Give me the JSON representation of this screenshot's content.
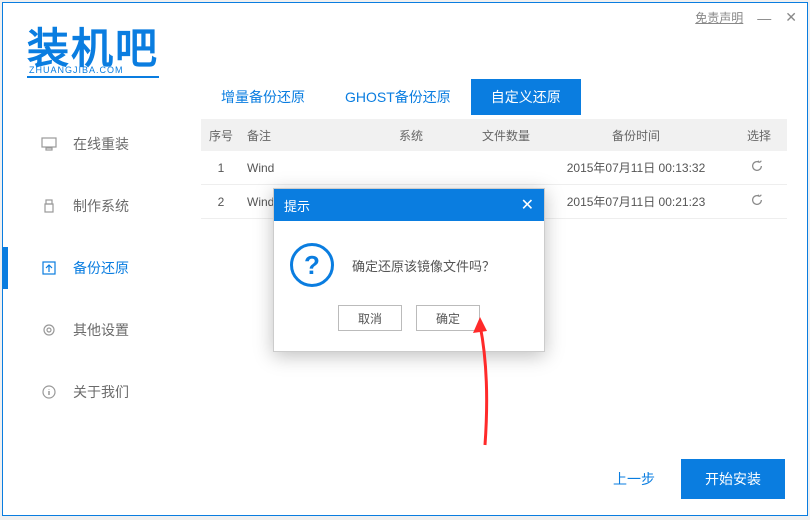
{
  "header": {
    "logo_main": "装机吧",
    "logo_sub": "ZHUANGJIBA.COM",
    "disclaimer": "免责声明"
  },
  "sidebar": {
    "items": [
      {
        "label": "在线重装"
      },
      {
        "label": "制作系统"
      },
      {
        "label": "备份还原"
      },
      {
        "label": "其他设置"
      },
      {
        "label": "关于我们"
      }
    ]
  },
  "tabs": [
    {
      "label": "增量备份还原"
    },
    {
      "label": "GHOST备份还原"
    },
    {
      "label": "自定义还原"
    }
  ],
  "table": {
    "headers": {
      "seq": "序号",
      "note": "备注",
      "system": "系统",
      "files": "文件数量",
      "time": "备份时间",
      "select": "选择"
    },
    "rows": [
      {
        "seq": "1",
        "note": "Wind",
        "time": "2015年07月11日 00:13:32"
      },
      {
        "seq": "2",
        "note": "Wind",
        "time": "2015年07月11日 00:21:23"
      }
    ]
  },
  "dialog": {
    "title": "提示",
    "message": "确定还原该镜像文件吗？",
    "cancel": "取消",
    "ok": "确定"
  },
  "footer": {
    "prev": "上一步",
    "install": "开始安装"
  }
}
